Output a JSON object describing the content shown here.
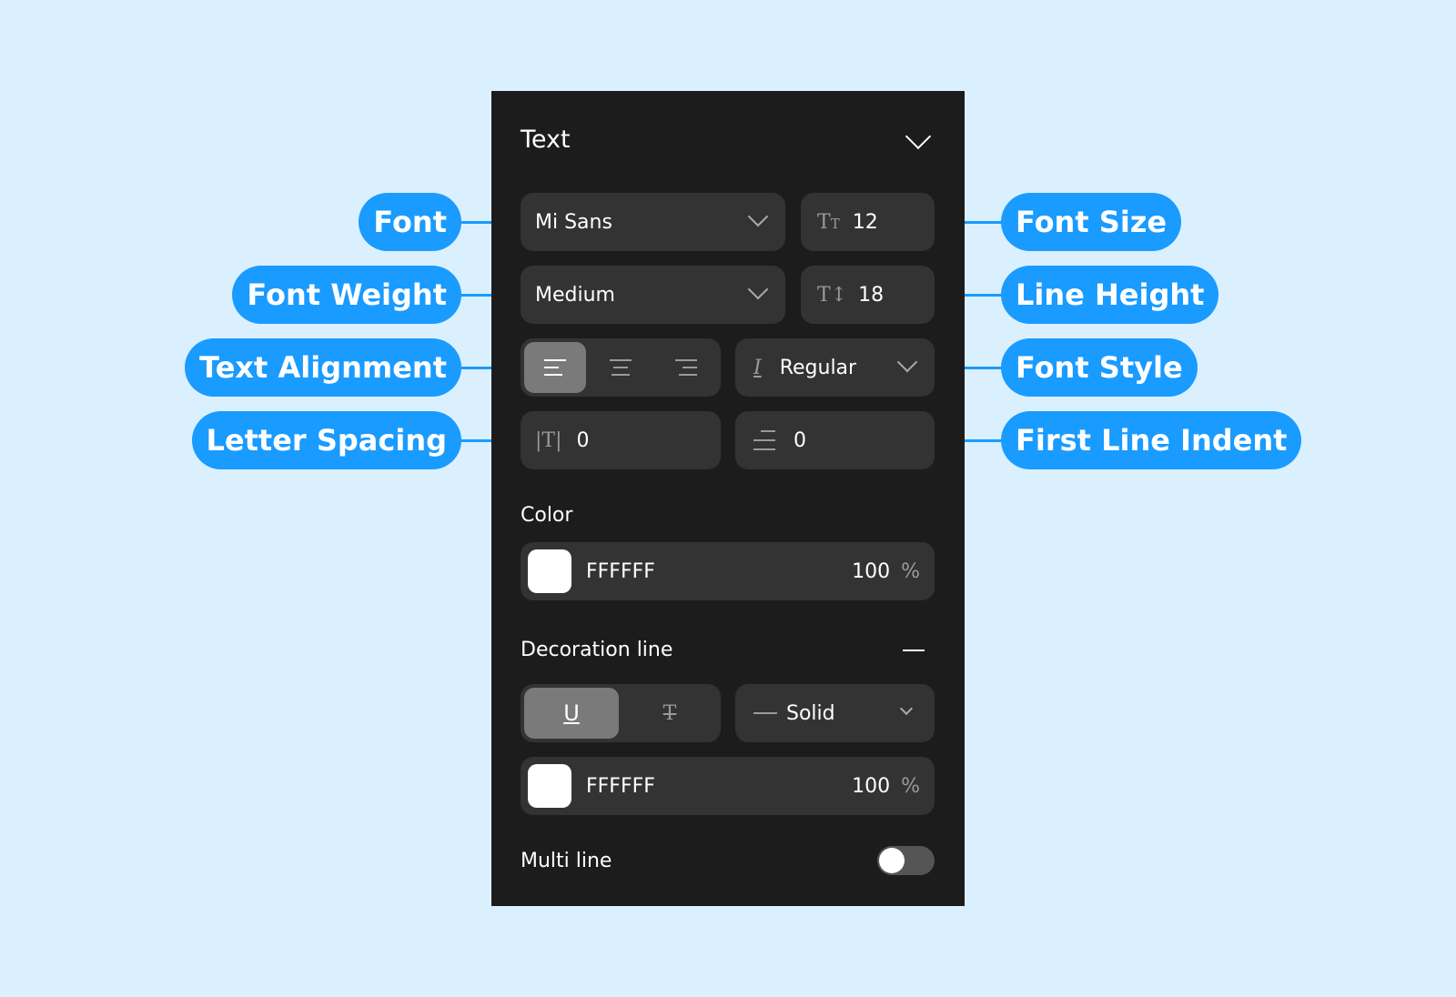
{
  "panel": {
    "title": "Text",
    "font": {
      "value": "Mi Sans"
    },
    "font_size": {
      "icon": "font-size-icon",
      "value": "12"
    },
    "font_weight": {
      "value": "Medium"
    },
    "line_height": {
      "icon": "line-height-icon",
      "value": "18"
    },
    "alignment": {
      "options": [
        "left",
        "center",
        "right"
      ],
      "selected": "left"
    },
    "font_style": {
      "icon": "italic-icon",
      "value": "Regular"
    },
    "letter_spacing": {
      "icon": "letter-spacing-icon",
      "value": "0"
    },
    "first_line_indent": {
      "icon": "indent-icon",
      "value": "0"
    },
    "color": {
      "label": "Color",
      "hex": "FFFFFF",
      "opacity": "100",
      "unit": "%",
      "swatch": "#FFFFFF"
    },
    "decoration": {
      "label": "Decoration line",
      "options": [
        "underline",
        "strikethrough"
      ],
      "selected": "underline",
      "style": "Solid",
      "hex": "FFFFFF",
      "opacity": "100",
      "unit": "%",
      "swatch": "#FFFFFF"
    },
    "multi_line": {
      "label": "Multi line",
      "on": false
    }
  },
  "callouts": {
    "font": "Font",
    "font_weight": "Font Weight",
    "text_alignment": "Text Alignment",
    "letter_spacing": "Letter Spacing",
    "font_size": "Font Size",
    "line_height": "Line Height",
    "font_style": "Font Style",
    "first_line_indent": "First Line Indent"
  },
  "colors": {
    "accent": "#1A9BFF",
    "background": "#DAF0FF",
    "panel": "#1C1C1C",
    "field": "#333333"
  }
}
